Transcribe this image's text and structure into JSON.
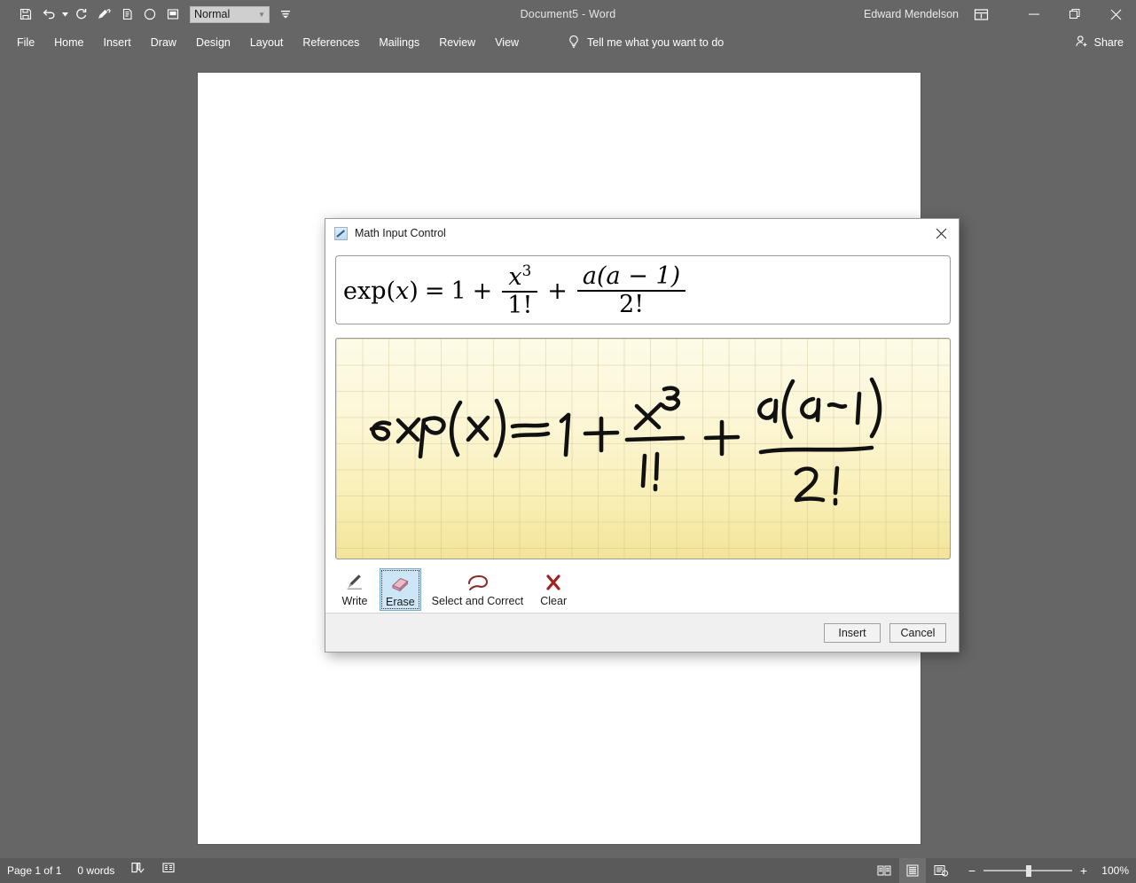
{
  "window": {
    "title": "Document5  -  Word",
    "user": "Edward Mendelson",
    "ribbon_display_icon": "ribbon-display-options-icon",
    "minimize_icon": "minimize-icon",
    "restore_icon": "restore-icon",
    "close_icon": "close-icon"
  },
  "quick_access": {
    "items": [
      {
        "icon": "save-icon",
        "label": "Save"
      },
      {
        "icon": "undo-icon",
        "label": "Undo"
      },
      {
        "icon": "undo-dropdown-caret-icon",
        "label": "Undo options"
      },
      {
        "icon": "redo-icon",
        "label": "Redo"
      },
      {
        "icon": "format-painter-icon",
        "label": "Format Painter"
      },
      {
        "icon": "paste-document-icon",
        "label": "Paste"
      },
      {
        "icon": "circle-icon",
        "label": "Shape"
      },
      {
        "icon": "window-layout-icon",
        "label": "Layout"
      }
    ],
    "style_value": "Normal",
    "style_dropdown_icon": "chevron-down-icon",
    "customize_icon": "customize-quick-access-toolbar-icon"
  },
  "ribbon": {
    "tabs": [
      "File",
      "Home",
      "Insert",
      "Draw",
      "Design",
      "Layout",
      "References",
      "Mailings",
      "Review",
      "View"
    ],
    "tell_me": "Tell me what you want to do",
    "tell_me_icon": "lightbulb-icon",
    "share_label": "Share",
    "share_icon": "person-add-icon"
  },
  "status_bar": {
    "page": "Page 1 of 1",
    "words": "0 words",
    "proofing_icon": "proofing-errors-icon",
    "language_icon": "accessibility-icon",
    "views": [
      {
        "icon": "read-mode-icon",
        "label": "Read Mode",
        "active": false
      },
      {
        "icon": "print-layout-icon",
        "label": "Print Layout",
        "active": true
      },
      {
        "icon": "web-layout-icon",
        "label": "Web Layout",
        "active": false
      }
    ],
    "zoom_out_icon": "minus-icon",
    "zoom_in_icon": "plus-icon",
    "zoom_level": "100%"
  },
  "dialog": {
    "title": "Math Input Control",
    "title_icon": "math-input-pen-icon",
    "close_icon": "close-icon",
    "preview": {
      "lhs": "exp",
      "lhs_var": "x",
      "equals": "=",
      "one": "1",
      "plus1": "+",
      "frac1_num_base": "x",
      "frac1_num_exp": "3",
      "frac1_den": "1!",
      "plus2": "+",
      "frac2_num": "a(a − 1)",
      "frac2_den": "2!",
      "plain_text": "exp(x) = 1 + x^3/1! + a(a − 1)/2!"
    },
    "ink": {
      "handwritten_text": "exp(x) = 1 + x³/1! + a(a-1)/2!",
      "background": "#fbf5cf",
      "grid_color": "#d8cf9b"
    },
    "tools": [
      {
        "label": "Write",
        "icon": "pen-icon",
        "selected": false
      },
      {
        "label": "Erase",
        "icon": "eraser-icon",
        "selected": true
      },
      {
        "label": "Select and Correct",
        "icon": "lasso-icon",
        "selected": false
      },
      {
        "label": "Clear",
        "icon": "red-x-icon",
        "selected": false
      }
    ],
    "buttons": {
      "insert": "Insert",
      "cancel": "Cancel"
    }
  },
  "colors": {
    "chrome": "#666666",
    "status_bar": "#5a5a5a",
    "page": "#ffffff",
    "selection_blue": "#cde6f7",
    "ink": "#111111"
  }
}
